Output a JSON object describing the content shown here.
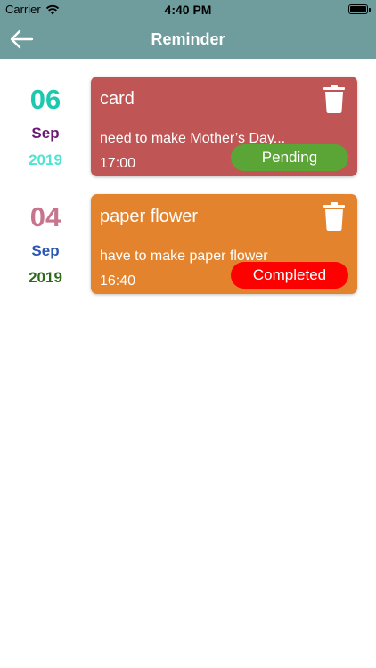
{
  "status_bar": {
    "carrier": "Carrier",
    "time": "4:40 PM"
  },
  "nav": {
    "title": "Reminder"
  },
  "reminders": [
    {
      "day": "06",
      "month": "Sep",
      "year": "2019",
      "day_color": "#1cc9b0",
      "month_color": "#6b1a72",
      "year_color": "#4fe3d2",
      "title": "card",
      "description": "need to make Mother’s Day...",
      "time": "17:00",
      "status": "Pending",
      "card_color": "#bf5554",
      "status_color": "#5ba436"
    },
    {
      "day": "04",
      "month": "Sep",
      "year": "2019",
      "day_color": "#c7758f",
      "month_color": "#2a57b3",
      "year_color": "#2f6a1b",
      "title": "paper flower",
      "description": "have to make paper flower",
      "time": "16:40",
      "status": "Completed",
      "card_color": "#e3832d",
      "status_color": "#ff0000"
    }
  ],
  "icons": {
    "back": "arrow-left-icon",
    "delete": "trash-icon",
    "wifi": "wifi-icon",
    "battery": "battery-icon"
  },
  "colors": {
    "header": "#6f9c9d"
  }
}
